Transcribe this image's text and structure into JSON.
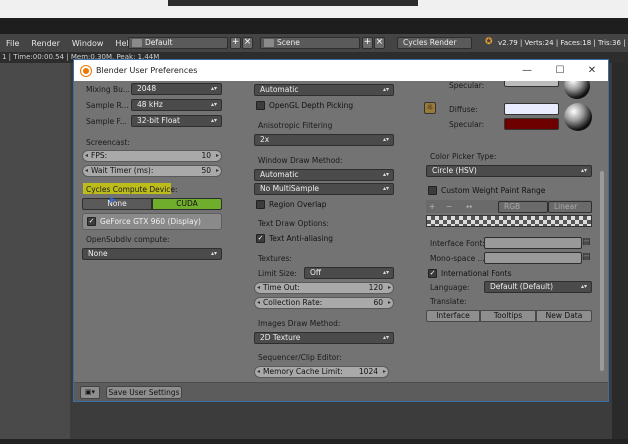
{
  "blender": {
    "menu": [
      "File",
      "Render",
      "Window",
      "Help"
    ],
    "layout_field": "Default",
    "scene_field": "Scene",
    "engine_field": "Cycles Render",
    "stats": "v2.79 | Verts:24 | Faces:18 | Tris:36 |",
    "status_line": "1 | Time:00:00.54 | Mem:0.30M, Peak: 1.44M"
  },
  "window": {
    "title": "Blender User Preferences",
    "controls": {
      "minimize": "—",
      "maximize": "☐",
      "close": "✕"
    }
  },
  "col1": {
    "mixing_buffer": {
      "label": "Mixing Bu...",
      "value": "2048"
    },
    "sample_rate": {
      "label": "Sample R...",
      "value": "48 kHz"
    },
    "sample_format": {
      "label": "Sample F...",
      "value": "32-bit Float"
    },
    "screencast_heading": "Screencast:",
    "fps": {
      "label": "FPS:",
      "value": "10"
    },
    "wait_timer": {
      "label": "Wait Timer (ms):",
      "value": "50"
    },
    "cycles_heading": "Cycles Compute Device:",
    "compute_none": "None",
    "compute_cuda": "CUDA",
    "gpu_device": "GeForce GTX 960 (Display)",
    "opensubdiv_heading": "OpenSubdiv compute:",
    "opensubdiv_value": "None"
  },
  "col2": {
    "top_dropdown": "Automatic",
    "opengl_depth_picking": "OpenGL Depth Picking",
    "anisotropic_heading": "Anisotropic Filtering",
    "anisotropic_value": "2x",
    "window_draw_heading": "Window Draw Method:",
    "window_draw_value": "Automatic",
    "multisample_value": "No MultiSample",
    "region_overlap": "Region Overlap",
    "text_draw_heading": "Text Draw Options:",
    "text_antialiasing": "Text Anti-aliasing",
    "textures_heading": "Textures:",
    "limit_size": {
      "label": "Limit Size:",
      "value": "Off"
    },
    "time_out": {
      "label": "Time Out:",
      "value": "120"
    },
    "collection_rate": {
      "label": "Collection Rate:",
      "value": "60"
    },
    "images_draw_heading": "Images Draw Method:",
    "images_draw_value": "2D Texture",
    "sequencer_heading": "Sequencer/Clip Editor:",
    "memory_cache": {
      "label": "Memory Cache Limit:",
      "value": "1024"
    }
  },
  "col3": {
    "specular_top": "Specular:",
    "diffuse": "Diffuse:",
    "specular": "Specular:",
    "color_picker_heading": "Color Picker Type:",
    "color_picker_value": "Circle (HSV)",
    "custom_weight": "Custom Weight Paint Range",
    "ramp_mode": "RGB",
    "ramp_interp": "Linear",
    "interface_font": "Interface Font:",
    "monospace_font": "Mono-space ...",
    "international_fonts": "International Fonts",
    "language": {
      "label": "Language:",
      "value": "Default (Default)"
    },
    "translate_heading": "Translate:",
    "translate_tabs": [
      "Interface",
      "Tooltips",
      "New Data"
    ],
    "colors": {
      "diffuse": "#e9ecff",
      "specular": "#6e0000"
    }
  },
  "footer": {
    "save_button": "Save User Settings"
  }
}
